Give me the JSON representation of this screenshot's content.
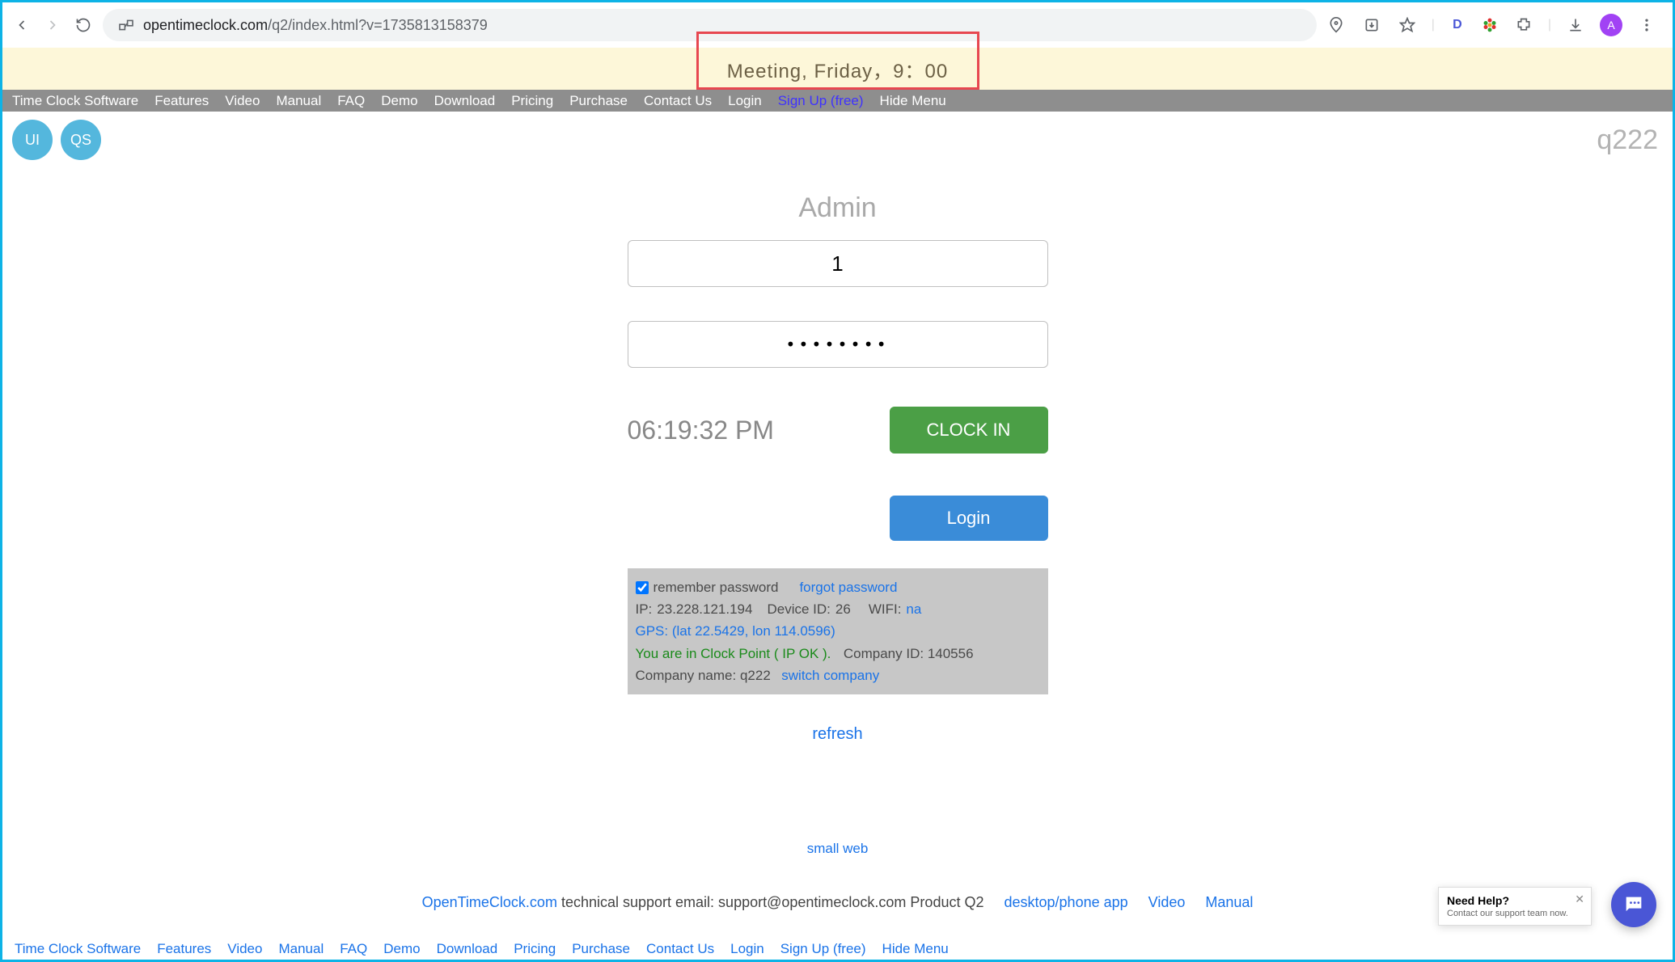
{
  "browser": {
    "url_domain": "opentimeclock.com",
    "url_path": "/q2/index.html?v=1735813158379",
    "avatar_letter": "A",
    "ext_d": "D"
  },
  "banner": {
    "text": "Meeting, Friday，9：00"
  },
  "nav": {
    "items": [
      "Time Clock Software",
      "Features",
      "Video",
      "Manual",
      "FAQ",
      "Demo",
      "Download",
      "Pricing",
      "Purchase",
      "Contact Us",
      "Login",
      "Sign Up (free)",
      "Hide Menu"
    ]
  },
  "top": {
    "chip1": "UI",
    "chip2": "QS",
    "brand": "q222"
  },
  "login": {
    "title": "Admin",
    "username": "1",
    "password_mask": "••••••••",
    "time": "06:19:32 PM",
    "clockin_label": "CLOCK IN",
    "login_label": "Login"
  },
  "info": {
    "remember_label": "remember password",
    "forgot_label": "forgot password",
    "ip_label": "IP:",
    "ip_value": "23.228.121.194",
    "device_label": "Device ID:",
    "device_value": "26",
    "wifi_label": "WIFI:",
    "wifi_value": "na",
    "gps_text": "GPS: (lat 22.5429, lon 114.0596)",
    "clockpoint_text": "You are in Clock Point ( IP OK ).",
    "company_id_label": "Company ID:",
    "company_id_value": "140556",
    "company_name_label": "Company name:",
    "company_name_value": "q222",
    "switch_label": "switch company"
  },
  "refresh_label": "refresh",
  "small_web_label": "small web",
  "footer": {
    "open_label": "OpenTimeClock.com",
    "support_text": " technical support email: support@opentimeclock.com Product Q2",
    "desktop_label": "desktop/phone app",
    "video_label": "Video",
    "manual_label": "Manual"
  },
  "help": {
    "title": "Need Help?",
    "sub": "Contact our support team now."
  }
}
